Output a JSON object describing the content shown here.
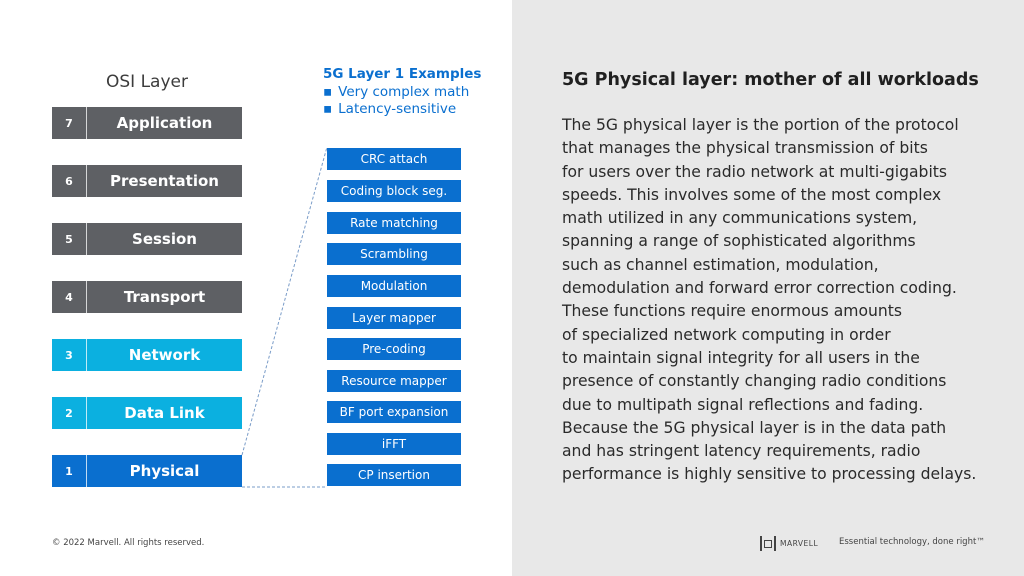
{
  "osi": {
    "title": "OSI Layer",
    "layers": [
      {
        "number": "7",
        "name": "Application",
        "color": "#5e6064"
      },
      {
        "number": "6",
        "name": "Presentation",
        "color": "#5e6064"
      },
      {
        "number": "5",
        "name": "Session",
        "color": "#5e6064"
      },
      {
        "number": "4",
        "name": "Transport",
        "color": "#5e6064"
      },
      {
        "number": "3",
        "name": "Network",
        "color": "#0bb0e0"
      },
      {
        "number": "2",
        "name": "Data Link",
        "color": "#0bb0e0"
      },
      {
        "number": "1",
        "name": "Physical",
        "color": "#0a6fcf"
      }
    ]
  },
  "examples": {
    "title": "5G Layer 1 Examples",
    "bullets": [
      "Very complex math",
      "Latency-sensitive"
    ],
    "steps": [
      "CRC attach",
      "Coding block seg.",
      "Rate matching",
      "Scrambling",
      "Modulation",
      "Layer mapper",
      "Pre-coding",
      "Resource mapper",
      "BF port expansion",
      "iFFT",
      "CP insertion"
    ]
  },
  "panel": {
    "title": "5G Physical layer: mother of all workloads",
    "body_lines": [
      "The 5G physical layer is the portion of the protocol",
      "that manages the physical transmission of bits",
      "for users over the radio network at multi-gigabits",
      "speeds. This involves some of the most complex",
      "math utilized in any communications system,",
      "spanning a range of sophisticated algorithms",
      "such as channel estimation, modulation,",
      "demodulation and forward error correction coding.",
      "These functions require enormous amounts",
      "of specialized network computing in order",
      "to maintain signal integrity for all users in the",
      "presence of constantly changing radio conditions",
      "due to multipath signal reflections and fading.",
      "Because the 5G physical layer is in the data path",
      "and has stringent latency requirements, radio",
      "performance is highly sensitive to processing delays."
    ]
  },
  "footer": {
    "copyright": "© 2022 Marvell. All rights reserved.",
    "logo_text": "MARVELL",
    "tagline": "Essential technology, done right™"
  },
  "colors": {
    "grey_layer": "#5e6064",
    "cyan_layer": "#0bb0e0",
    "blue_accent": "#0a6fcf",
    "panel_bg": "#e8e8e8"
  }
}
